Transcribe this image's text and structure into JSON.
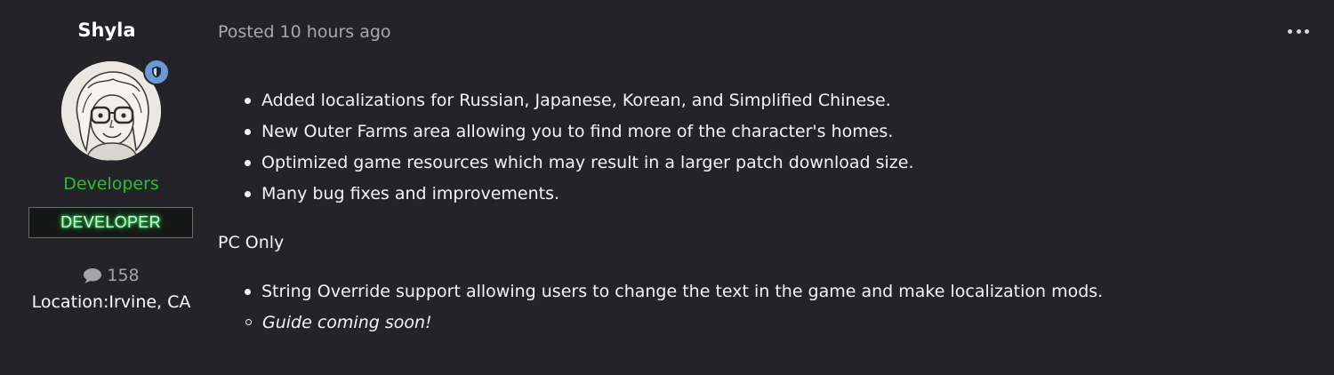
{
  "author": {
    "name": "Shyla",
    "group": "Developers",
    "rank_badge": "DEVELOPER",
    "post_count": "158",
    "location_label": "Location:",
    "location_value": "Irvine, CA"
  },
  "post": {
    "posted_label": "Posted 10 hours ago",
    "bullets": [
      "Added localizations for Russian, Japanese, Korean, and Simplified Chinese.",
      "New Outer Farms area allowing you to find more of the character's homes.",
      "Optimized game resources which may result in a larger patch download size.",
      "Many bug fixes and improvements."
    ],
    "section_heading": "PC Only",
    "pc_bullets": [
      "String Override support allowing users to change the text in the game and make localization mods."
    ],
    "pc_sub_bullets": [
      "Guide coming soon!"
    ]
  },
  "icons": {
    "menu": "ellipsis-icon",
    "moderator": "shield-icon",
    "posts": "speech-bubble-icon"
  },
  "colors": {
    "background": "#232328",
    "group": "#21c42e",
    "moderator_badge": "#6a9ad6",
    "muted_text": "#a8a8ad"
  }
}
